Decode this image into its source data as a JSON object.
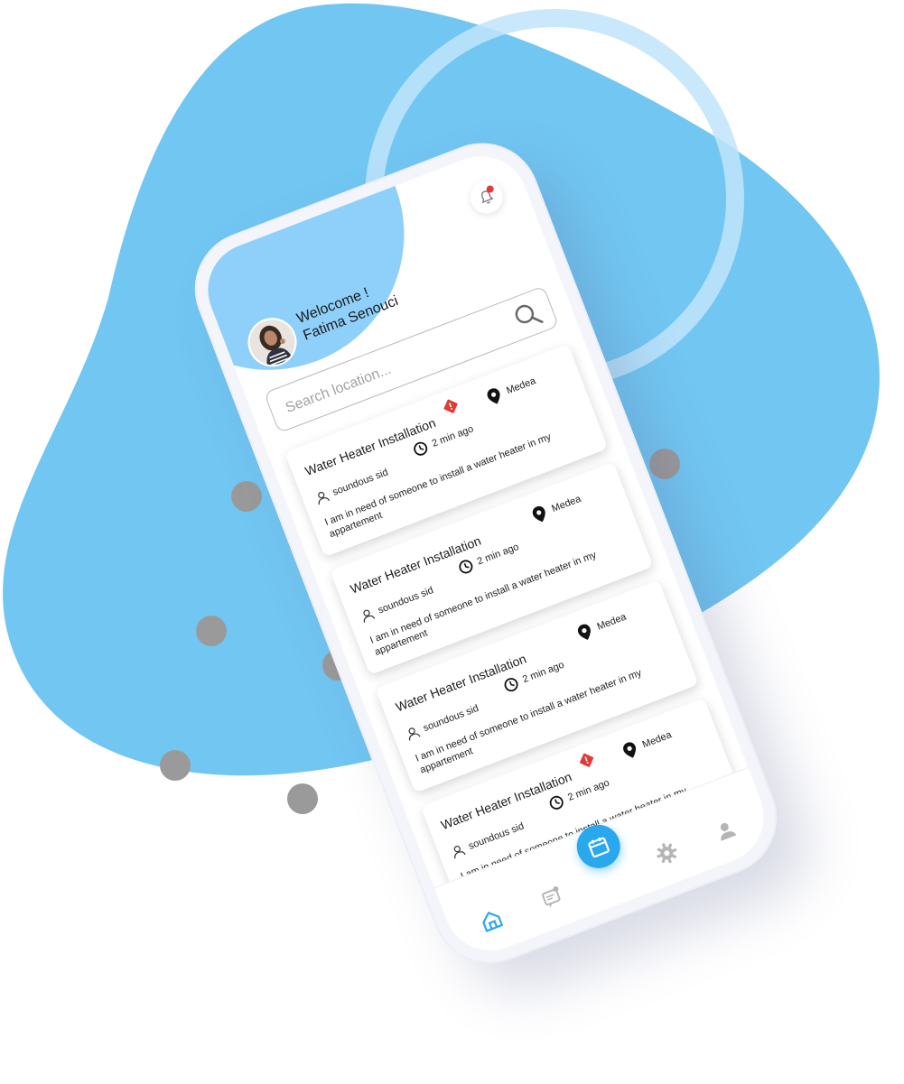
{
  "colors": {
    "accent": "#29a8ee",
    "blob_main": "#72c6f2",
    "ring": "#bfe4fb",
    "header_blob": "#8fd0fa",
    "dots": "#9a9a9a",
    "badge_red": "#e53935"
  },
  "header": {
    "greeting": "Welocome !",
    "user_name": "Fatima Senouci",
    "avatar_icon": "avatar-photo",
    "notification_icon": "bell-icon"
  },
  "search": {
    "placeholder": "Search location...",
    "icon": "search-icon"
  },
  "requests": [
    {
      "title": "Water Heater Installation",
      "urgent": true,
      "time": "2 min ago",
      "location": "Medea",
      "author": "soundous sid",
      "description": "I am in need of someone to install a water heater in my appartement"
    },
    {
      "title": "Water Heater Installation",
      "urgent": false,
      "time": "2 min ago",
      "location": "Medea",
      "author": "soundous sid",
      "description": "I am in need of someone to install a water heater in my appartement"
    },
    {
      "title": "Water Heater Installation",
      "urgent": false,
      "time": "2 min ago",
      "location": "Medea",
      "author": "soundous sid",
      "description": "I am in need of someone to install a water heater in my appartement"
    },
    {
      "title": "Water Heater Installation",
      "urgent": true,
      "time": "2 min ago",
      "location": "Medea",
      "author": "soundous sid",
      "description": "I am in need of someone to install a water heater in my appartement"
    }
  ],
  "bottom_nav": {
    "items": [
      {
        "icon": "home-icon",
        "active": true
      },
      {
        "icon": "messages-icon",
        "active": false
      },
      {
        "icon": "calendar-icon",
        "active": false
      },
      {
        "icon": "gear-icon",
        "active": false
      },
      {
        "icon": "profile-icon",
        "active": false
      }
    ]
  }
}
